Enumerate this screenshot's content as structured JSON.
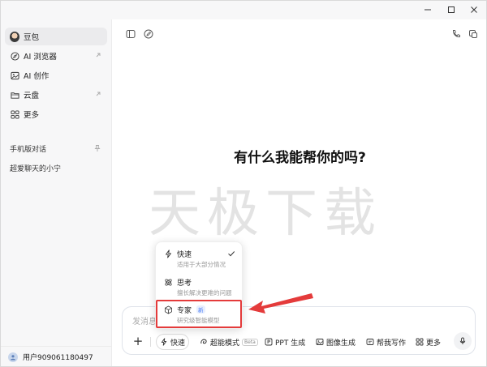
{
  "sidebar": {
    "items": [
      {
        "label": "豆包",
        "icon": "doubao-avatar",
        "active": true
      },
      {
        "label": "AI 浏览器",
        "icon": "compass-icon",
        "external": true
      },
      {
        "label": "AI 创作",
        "icon": "image-icon"
      },
      {
        "label": "云盘",
        "icon": "folder-icon",
        "external": true
      },
      {
        "label": "更多",
        "icon": "grid-icon"
      }
    ],
    "section_title": "手机版对话",
    "conversations": [
      {
        "label": "超爱聊天的小宁"
      }
    ],
    "user": {
      "name": "用户909061180497"
    }
  },
  "main": {
    "headline": "有什么我能帮你的吗?",
    "watermark": "天极下载"
  },
  "dropdown": {
    "items": [
      {
        "title": "快速",
        "desc": "适用于大部分情况",
        "icon": "lightning-icon",
        "checked": true
      },
      {
        "title": "思考",
        "desc": "擅长解决更难的问题",
        "icon": "atom-icon"
      },
      {
        "title": "专家",
        "desc": "研究级智能模型",
        "icon": "cube-icon",
        "badge": "新"
      }
    ]
  },
  "input": {
    "placeholder": "发消息",
    "mode_label": "快速",
    "buttons": [
      {
        "label": "超能模式",
        "badge": "Beta",
        "icon": "swirl-icon"
      },
      {
        "label": "PPT 生成",
        "icon": "ppt-icon"
      },
      {
        "label": "图像生成",
        "icon": "picture-icon"
      },
      {
        "label": "帮我写作",
        "icon": "pen-icon"
      },
      {
        "label": "更多",
        "icon": "grid-icon"
      }
    ]
  },
  "colors": {
    "accent_blue": "#4a7cf5",
    "annotation_red": "#e43b3b"
  }
}
